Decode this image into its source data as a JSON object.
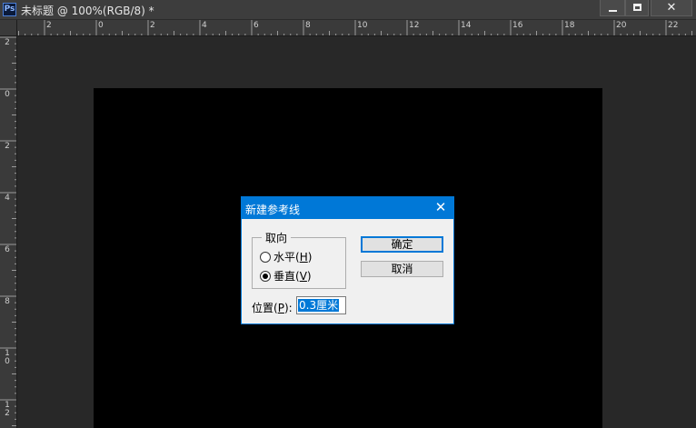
{
  "window": {
    "app_icon_text": "Ps",
    "title": "未标题 @ 100%(RGB/8) *",
    "min_icon": "minimize-icon",
    "max_icon": "maximize-icon",
    "close_glyph": "✕"
  },
  "rulers": {
    "horizontal_labels": [
      "2",
      "0",
      "2",
      "4",
      "6",
      "8",
      "10",
      "12",
      "14",
      "16",
      "18",
      "20",
      "22"
    ],
    "vertical_labels": [
      "2",
      "0",
      "2",
      "4",
      "6",
      "8",
      "10",
      "12"
    ]
  },
  "canvas": {
    "background": "#000000"
  },
  "dialog": {
    "title": "新建参考线",
    "close_glyph": "✕",
    "orientation_group": "取向",
    "radio_horizontal": {
      "label": "水平(",
      "hotkey": "H",
      "suffix": ")",
      "checked": false
    },
    "radio_vertical": {
      "label": "垂直(",
      "hotkey": "V",
      "suffix": ")",
      "checked": true
    },
    "ok_label": "确定",
    "cancel_label": "取消",
    "position_label": "位置(",
    "position_hotkey": "P",
    "position_suffix": "):",
    "position_value": "0.3厘米",
    "accent": "#0078d7"
  }
}
